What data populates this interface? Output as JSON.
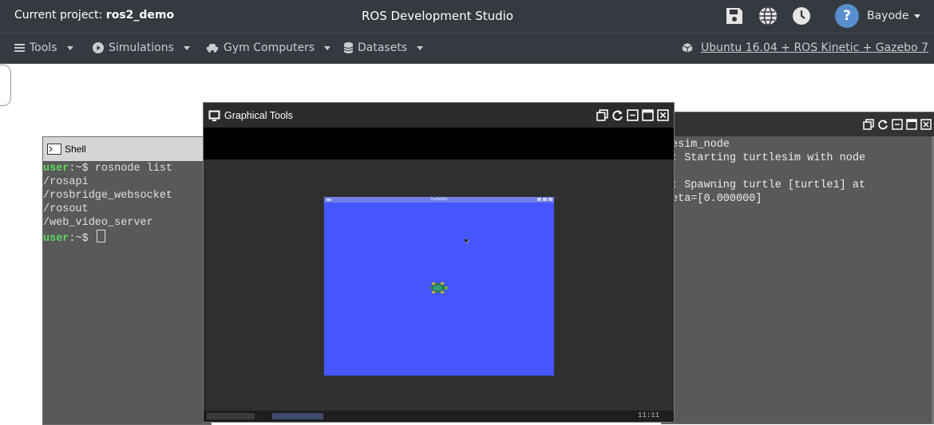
{
  "topbar": {
    "project_prefix": "Current project:",
    "project_name": "ros2_demo",
    "app_title": "ROS Development Studio",
    "user_name": "Bayode",
    "help_glyph": "?",
    "icons": [
      "save-icon",
      "globe-icon",
      "clock-icon",
      "help-icon"
    ]
  },
  "menubar": {
    "tools": "Tools",
    "simulations": "Simulations",
    "gym_computers": "Gym Computers",
    "datasets": "Datasets",
    "environment": "Ubuntu 16.04 + ROS Kinetic + Gazebo 7"
  },
  "shell": {
    "title": "Shell",
    "prompt_user": "user",
    "prompt_rest": ":~$ ",
    "command": "rosnode list",
    "output": [
      "/rosapi",
      "/rosbridge_websocket",
      "/rosout",
      "/web_video_server"
    ]
  },
  "graphical_tools": {
    "title": "Graphical Tools",
    "turtlesim_title": "TurtleSim",
    "taskbar_clock": "11:11"
  },
  "log": {
    "lines": [
      "esim_node",
      ": Starting turtlesim with node",
      "",
      ": Spawning turtle [turtle1] at",
      "eta=[0.000000]"
    ]
  },
  "colors": {
    "topbar_bg": "#343a40",
    "turtlesim_bg": "#4556ff",
    "prompt_green": "#5fd75f"
  }
}
